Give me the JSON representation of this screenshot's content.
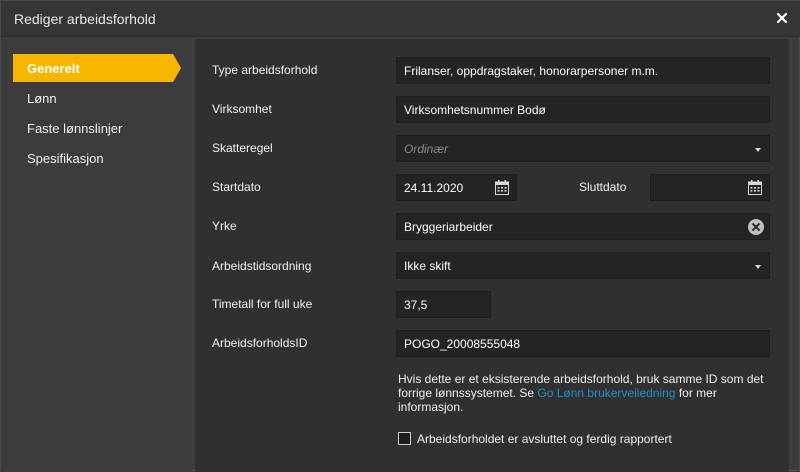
{
  "dialog": {
    "title": "Rediger arbeidsforhold"
  },
  "sidebar": {
    "items": [
      {
        "label": "Generelt",
        "active": true
      },
      {
        "label": "Lønn"
      },
      {
        "label": "Faste lønnslinjer"
      },
      {
        "label": "Spesifikasjon"
      }
    ]
  },
  "form": {
    "type": {
      "label": "Type arbeidsforhold",
      "value": "Frilanser, oppdragstaker, honorarpersoner m.m."
    },
    "company": {
      "label": "Virksomhet",
      "value": "Virksomhetsnummer Bodø"
    },
    "tax_rule": {
      "label": "Skatteregel",
      "placeholder": "Ordinær"
    },
    "start_date": {
      "label": "Startdato",
      "value": "24.11.2020"
    },
    "end_date": {
      "label": "Sluttdato",
      "value": ""
    },
    "occupation": {
      "label": "Yrke",
      "value": "Bryggeriarbeider"
    },
    "work_schedule": {
      "label": "Arbeidstidsordning",
      "value": "Ikke skift"
    },
    "hours_full_week": {
      "label": "Timetall for full uke",
      "value": "37,5"
    },
    "employment_id": {
      "label": "ArbeidsforholdsID",
      "value": "POGO_20008555048"
    }
  },
  "help": {
    "text_before": "Hvis dette er et eksisterende arbeidsforhold, bruk samme ID som det forrige lønnssystemet. Se ",
    "link": "Go Lønn brukerveiledning",
    "text_after": " for mer informasjon."
  },
  "completed_checkbox": {
    "label": "Arbeidsforholdet er avsluttet og ferdig rapportert",
    "checked": false
  },
  "colors": {
    "accent": "#f7b500",
    "link": "#1e90c9",
    "field_bg": "#242424",
    "panel_bg": "#303030"
  }
}
